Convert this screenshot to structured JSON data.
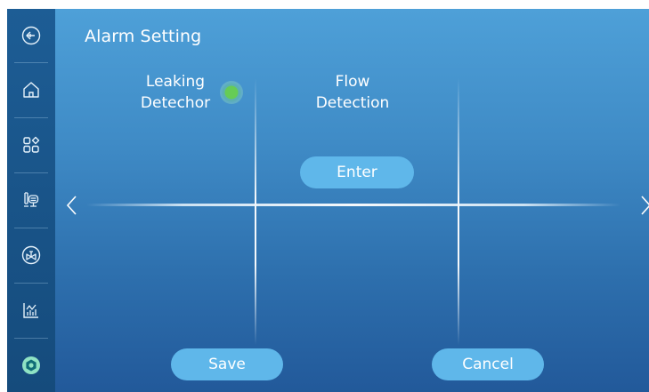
{
  "page": {
    "title": "Alarm Setting"
  },
  "sidebar": {
    "items": [
      {
        "name": "back",
        "icon": "back-arrow-icon"
      },
      {
        "name": "home",
        "icon": "home-icon"
      },
      {
        "name": "apps",
        "icon": "grid-apps-icon"
      },
      {
        "name": "device",
        "icon": "filter-device-icon"
      },
      {
        "name": "valve",
        "icon": "valve-icon"
      },
      {
        "name": "chart",
        "icon": "chart-icon"
      },
      {
        "name": "settings",
        "icon": "settings-active-icon",
        "active": true
      }
    ]
  },
  "columns": {
    "leaking": {
      "line1": "Leaking",
      "line2": "Detechor",
      "status": "on"
    },
    "flow": {
      "line1": "Flow",
      "line2": "Detection"
    }
  },
  "buttons": {
    "enter": "Enter",
    "save": "Save",
    "cancel": "Cancel"
  },
  "colors": {
    "sidebar": "#1a5488",
    "main_top": "#4ea0d8",
    "main_bottom": "#22599a",
    "button": "#5fb7ea",
    "indicator": "#66cc55",
    "active_icon": "#8fe3c4"
  }
}
